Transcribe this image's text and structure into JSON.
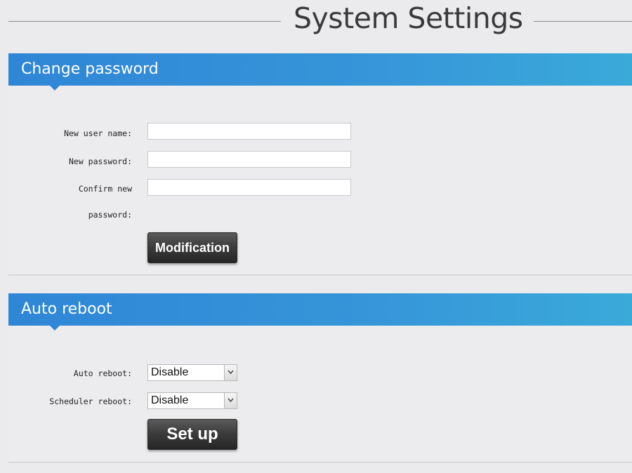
{
  "page": {
    "title": "System Settings"
  },
  "change_password": {
    "title": "Change password",
    "new_user_name_label": "New user name:",
    "new_user_name_value": "",
    "new_password_label": "New password:",
    "new_password_value": "",
    "confirm_label_line1": "Confirm new",
    "confirm_label_line2": "password:",
    "confirm_value": "",
    "modify_button": "Modification"
  },
  "auto_reboot": {
    "title": "Auto reboot",
    "auto_reboot_label": "Auto reboot:",
    "auto_reboot_value": "Disable",
    "scheduler_reboot_label": "Scheduler reboot:",
    "scheduler_reboot_value": "Disable",
    "setup_button": "Set up"
  },
  "colors": {
    "header_blue": "#2f86d6",
    "header_blue_light": "#3aaad9",
    "button_dark": "#3a3a3a",
    "background": "#ebebed"
  },
  "icons": {
    "select_arrow": "chevron-down-icon",
    "header_pointer": "pointer-triangle-icon"
  }
}
